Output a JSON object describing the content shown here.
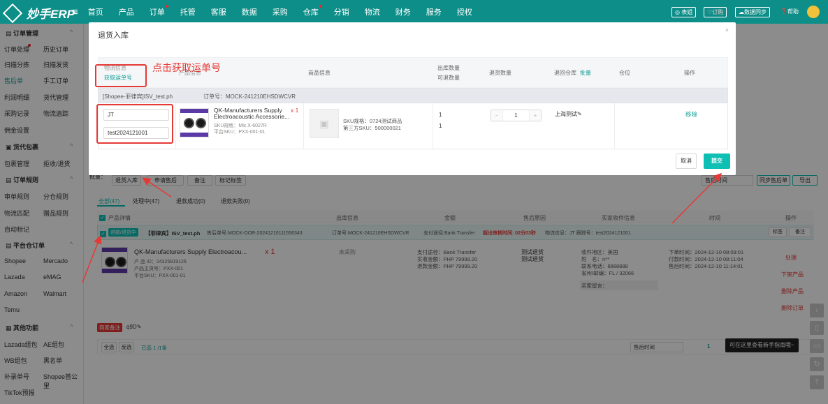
{
  "topbar": {
    "logo": "妙手ERP",
    "nav": [
      "首页",
      "产品",
      "订单",
      "托管",
      "客服",
      "数据",
      "采购",
      "仓库",
      "分销",
      "物流",
      "财务",
      "服务",
      "授权"
    ],
    "buttons": [
      "表姐",
      "订购",
      "数据同步",
      "帮助"
    ]
  },
  "sidebar": {
    "sections": [
      {
        "title": "订单管理",
        "items": [
          "订单处理",
          "历史订单",
          "扫描分拣",
          "扫描发货",
          "售后单",
          "手工订单",
          "利润明细",
          "货代管理",
          "采购记录",
          "物流追踪",
          "佣金设置"
        ]
      },
      {
        "title": "货代包裹",
        "items": [
          "包裹管理",
          "拒收/退货"
        ]
      },
      {
        "title": "订单规则",
        "items": [
          "审单规则",
          "分仓规则",
          "物流匹配",
          "赠品规则",
          "自动标记"
        ]
      },
      {
        "title": "平台仓订单",
        "items": [
          "Shopee",
          "Mercado",
          "Lazada",
          "eMAG",
          "Amazon",
          "Walmart",
          "Temu"
        ]
      },
      {
        "title": "其他功能",
        "items": [
          "Lazada组包",
          "AE组包",
          "WB组包",
          "黑名单",
          "补录单号",
          "Shopee首公里",
          "TikTok预报"
        ]
      }
    ]
  },
  "modal": {
    "title": "退货入库",
    "close": "×",
    "headers": {
      "logistics": "物流信息",
      "get_tracking": "获取运单号",
      "product": "产品信息",
      "goods": "商品信息",
      "out_qty": "出库数量",
      "returnable_qty": "可退数量",
      "return_qty": "退货数量",
      "warehouse": "退回仓库",
      "batch": "批量",
      "location": "仓位",
      "op": "操作"
    },
    "group": {
      "shop": "[Shopee-菲律宾]ISV_test.ph",
      "order_no": "订单号：MOCK-241210EHSDWCVR"
    },
    "row": {
      "carrier": "JT",
      "tracking": "test2024121001",
      "product_title": "QK-Manufacturers Supply Electroacoustic Accessorie...",
      "product_qty": "x 1",
      "sku_spec": "SKU规格：Mic.X-6027R",
      "platform_sku": "平台SKU：PXX-001-01",
      "goods_sku": "SKU规格：0724测试商品",
      "third_sku": "第三方SKU：500000021",
      "out_qty": "1",
      "returnable": "1",
      "return_qty": "1",
      "warehouse": "上海测试",
      "remove": "移除"
    },
    "cancel": "取消",
    "submit": "提交"
  },
  "annotation": "点击获取运单号",
  "bg": {
    "batch_label": "批量：",
    "batch_buttons": [
      "退货入库",
      "申请售后",
      "备注",
      "标记标签"
    ],
    "tabs": [
      "全部(47)",
      "处理中(47)",
      "退款成功(0)",
      "退款失败(0)"
    ],
    "right_buttons": [
      "同步售后单",
      "导出"
    ],
    "sort": "售后时间",
    "cols": [
      "产品详情",
      "出库信息",
      "金额",
      "售后原因",
      "买家收件信息",
      "时间",
      "操作"
    ],
    "order_head": {
      "tag": "退款/退货中",
      "shop": "【菲律宾】ISV_test.ph",
      "after_no": "售后单号:MOCK-OOR-20241210111556343",
      "order_no": "订单号:MOCK-241210EHSDWCVR",
      "pay": "支付途径:Bank Transfer",
      "deadline": "超出审核时间: 02分03秒",
      "logistics": "物流信息：JT 跟踪号：test2024121001",
      "tag_btn": "标签",
      "note_btn": "备注"
    },
    "item": {
      "title": "QK-Manufacturers Supply Electroacou...",
      "qty": "x 1",
      "id": "产 品 ID：24325819126",
      "sku": "产品主货号：PXX-001",
      "psku": "平台SKU：PXX-001-01",
      "status": "未采购",
      "pay": "支付途径：Bank Transfer",
      "paid": "实收金额：PHP 79999.20",
      "refund": "退款金额：PHP 79999.20",
      "reason1": "测试退货",
      "reason2": "测试退货",
      "region": "收件地区：美国",
      "name": "姓　名：n**",
      "phone": "联系电话：8888888",
      "state": "省州/邮编：FL / 32066",
      "buyer_note": "买家留言：",
      "t1": "下单时间：2024-12-10 08:09:01",
      "t2": "付款时间：2024-12-10 08:11:04",
      "t3": "售后时间：2024-12-10 11:14:01",
      "ops": [
        "处理",
        "下架产品",
        "删除产品",
        "删除订单"
      ]
    },
    "merchant_note": "商家备注",
    "note_val": "q9D",
    "footer": {
      "select_all": "全选",
      "invert": "反选",
      "selected": "已选 1 /1条",
      "sort": "售后时间",
      "page": "1"
    },
    "tooltip": "可在这里查看新手指南哦~"
  }
}
